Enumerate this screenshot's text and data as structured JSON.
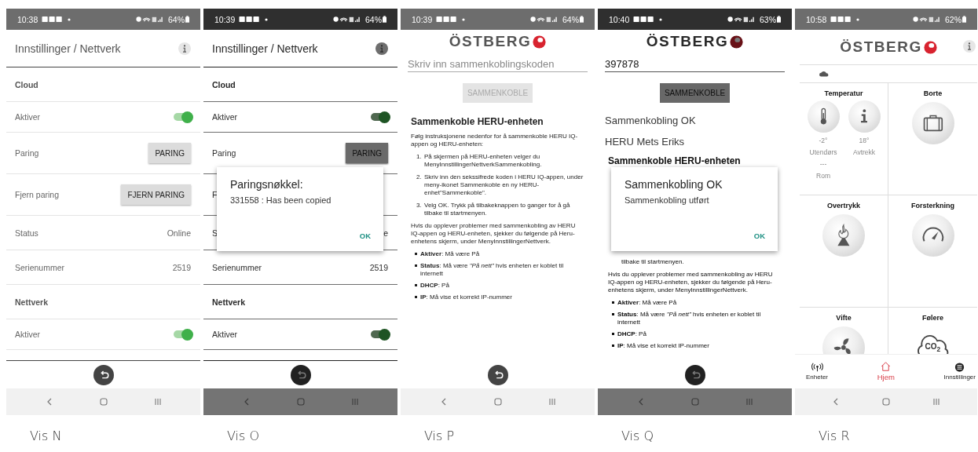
{
  "phones": [
    {
      "kind": "settings",
      "caption": "Vis N",
      "status": {
        "time": "10:38",
        "battery": "64%"
      },
      "header": {
        "title": "Innstillinger / Nettverk"
      },
      "rows": [
        {
          "kind": "section",
          "label": "Cloud"
        },
        {
          "kind": "toggle",
          "label": "Aktiver",
          "on": true
        },
        {
          "kind": "button",
          "label": "Paring",
          "button": "PARING"
        },
        {
          "kind": "button",
          "label": "Fjern paring",
          "button": "FJERN PARING"
        },
        {
          "kind": "value",
          "label": "Status",
          "value": "Online"
        },
        {
          "kind": "value",
          "label": "Serienummer",
          "value": "2519"
        },
        {
          "kind": "section",
          "label": "Nettverk"
        },
        {
          "kind": "toggle",
          "label": "Aktiver",
          "on": true
        }
      ]
    },
    {
      "kind": "settings",
      "caption": "Vis O",
      "status": {
        "time": "10:39",
        "battery": "64%"
      },
      "header": {
        "title": "Innstillinger / Nettverk"
      },
      "rows": [
        {
          "kind": "section",
          "label": "Cloud"
        },
        {
          "kind": "toggle",
          "label": "Aktiver",
          "on": true
        },
        {
          "kind": "button",
          "label": "Paring",
          "button": "PARING"
        },
        {
          "kind": "covered",
          "label": "F"
        },
        {
          "kind": "value",
          "label": "S",
          "value": "e"
        },
        {
          "kind": "value",
          "label": "Serienummer",
          "value": "2519"
        },
        {
          "kind": "section",
          "label": "Nettverk"
        },
        {
          "kind": "toggle",
          "label": "Aktiver",
          "on": true
        }
      ],
      "dialog": {
        "title": "Paringsnøkkel:",
        "message": "331558 : Has been copied",
        "button": "OK"
      }
    },
    {
      "kind": "pairing",
      "caption": "Vis P",
      "status": {
        "time": "10:39",
        "battery": "64%"
      },
      "logo": "ÖSTBERG",
      "field": {
        "placeholder": "Skriv inn sammenkoblingskoden"
      },
      "connect": {
        "label": "SAMMENKOBLE",
        "disabled": true
      },
      "guide": {
        "heading": "Sammenkoble HERU-enheten",
        "intro": "Følg instruksjonene nedenfor for å sammenkoble HERU IQ-appen og HERU-enheten:",
        "steps": [
          {
            "number": "1.",
            "text": "På skjermen på HERU-enheten velger du MenyInnstillingerNettverkSammenkobling."
          },
          {
            "number": "2.",
            "text": "Skriv inn den sekssifrede koden i HERU IQ-appen, under meny-ikonet  Sammenkoble en ny HERU-enhet\"Sammenkoble\"."
          },
          {
            "number": "3.",
            "text": "Velg OK. Trykk på tilbakeknappen to ganger for å gå tilbake til startmenyen."
          }
        ],
        "note": "Hvis du opplever problemer med sammenkobling av HERU IQ-appen og HERU-enheten, sjekker du følgende på Heru-enhetens skjerm, under MenyInnstillingerNettverk.",
        "bullets": [
          "**Aktiver**: Må være På",
          "**Status**: Må være *\"På nett\"* hvis enheten er koblet til internett",
          "**DHCP**: På",
          "**IP**: Må vise et korrekt IP-nummer"
        ]
      }
    },
    {
      "kind": "pairing",
      "caption": "Vis Q",
      "status": {
        "time": "10:40",
        "battery": "63%"
      },
      "logo": "ÖSTBERG",
      "field": {
        "value": "397878"
      },
      "connect": {
        "label": "SAMMENKOBLE",
        "disabled": false
      },
      "results": [
        "Sammenkobling OK",
        "HERU Mets Eriks"
      ],
      "guide": {
        "heading": "Sammenkoble HERU-enheten",
        "steps": [
          {
            "text": "tilbake til startmenyen."
          }
        ],
        "note": "Hvis du opplever problemer med sammenkobling av HERU IQ-appen og HERU-enheten, sjekker du følgende på Heru-enhetens skjerm, under MenyInnstillingerNettverk.",
        "bullets": [
          "**Aktiver**: Må være På",
          "**Status**: Må være *\"På nett\"* hvis enheten er koblet til internett",
          "**DHCP**: På",
          "**IP**: Må vise et korrekt IP-nummer"
        ]
      },
      "dialog": {
        "title": "Sammenkobling OK",
        "message": "Sammenkobling utført",
        "button": "OK"
      }
    },
    {
      "kind": "home",
      "caption": "Vis R",
      "status": {
        "time": "10:58",
        "battery": "62%"
      },
      "logo": "ÖSTBERG",
      "tiles": [
        {
          "kind": "temperature",
          "title": "Temperatur",
          "readings": [
            {
              "value": "-2°",
              "label": "Utendørs"
            },
            {
              "value": "18°",
              "label": "Avtrekk"
            },
            {
              "value": "---",
              "label": "Rom"
            }
          ]
        },
        {
          "kind": "away",
          "title": "Borte"
        },
        {
          "kind": "overpressure",
          "title": "Overtrykk"
        },
        {
          "kind": "boost",
          "title": "Forsterkning"
        },
        {
          "kind": "fan",
          "title": "Vifte"
        },
        {
          "kind": "sensors",
          "title": "Følere",
          "badge": "CO$_{2}$"
        }
      ],
      "tabs": [
        {
          "kind": "devices",
          "label": "Enheter",
          "selected": false
        },
        {
          "kind": "home",
          "label": "Hjem",
          "selected": true
        },
        {
          "kind": "settings",
          "label": "Innstillinger",
          "selected": false
        }
      ]
    }
  ]
}
